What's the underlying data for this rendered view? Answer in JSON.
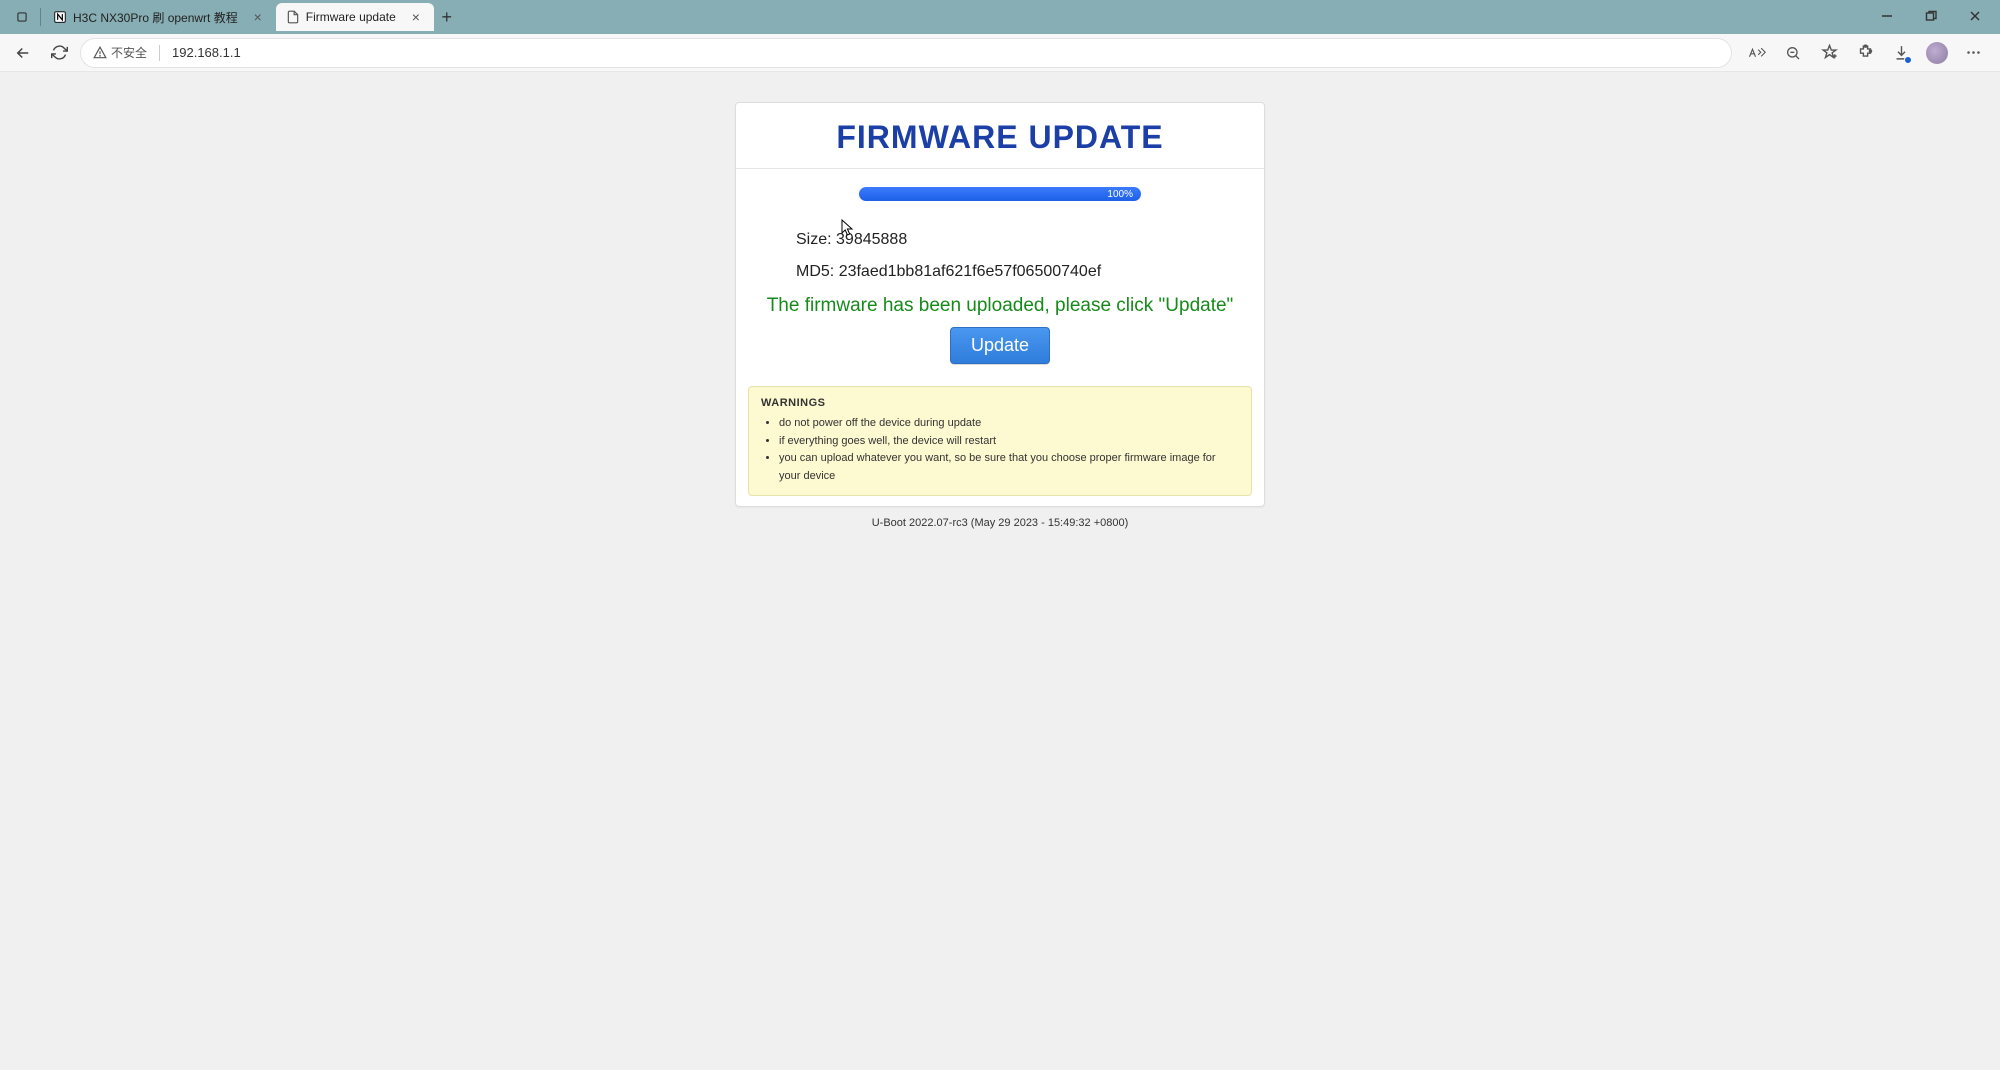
{
  "browser": {
    "tabs": [
      {
        "title": "H3C NX30Pro 刷 openwrt 教程",
        "active": false,
        "icon": "notion"
      },
      {
        "title": "Firmware update",
        "active": true,
        "icon": "file"
      }
    ],
    "security_label": "不安全",
    "url": "192.168.1.1"
  },
  "page": {
    "title": "FIRMWARE UPDATE",
    "progress_label": "100%",
    "size_label": "Size:",
    "size_value": "39845888",
    "md5_label": "MD5:",
    "md5_value": "23faed1bb81af621f6e57f06500740ef",
    "status_text": "The firmware has been uploaded, please click \"Update\"",
    "update_button": "Update",
    "warnings_heading": "WARNINGS",
    "warnings": [
      "do not power off the device during update",
      "if everything goes well, the device will restart",
      "you can upload whatever you want, so be sure that you choose proper firmware image for your device"
    ],
    "footer": "U-Boot 2022.07-rc3 (May 29 2023 - 15:49:32 +0800)"
  }
}
